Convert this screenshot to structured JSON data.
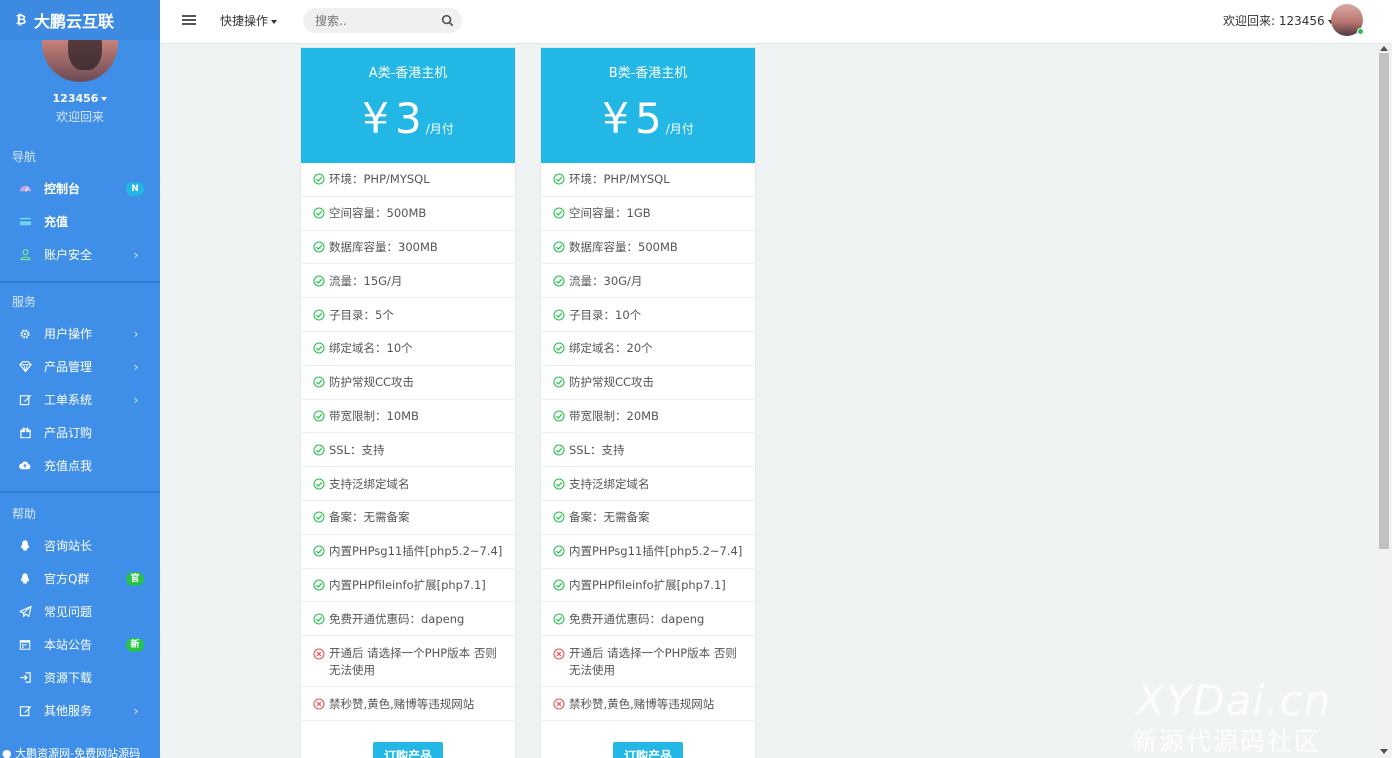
{
  "brand": {
    "logo_icon": "bitcoin-icon",
    "name": "大鹏云互联"
  },
  "user": {
    "name": "123456",
    "subtitle": "欢迎回来"
  },
  "sidebar": {
    "sections": [
      {
        "title": "导航",
        "items": [
          {
            "label": "控制台",
            "icon": "dashboard-icon",
            "badge": "N",
            "badge_color": "#23b7e5",
            "has_chevron": false
          },
          {
            "label": "充值",
            "icon": "credit-card-icon",
            "badge": "",
            "has_chevron": false
          },
          {
            "label": "账户安全",
            "icon": "user-icon",
            "badge": "",
            "has_chevron": true
          }
        ]
      },
      {
        "title": "服务",
        "items": [
          {
            "label": "用户操作",
            "icon": "gear-icon",
            "badge": "",
            "has_chevron": true
          },
          {
            "label": "产品管理",
            "icon": "diamond-icon",
            "badge": "",
            "has_chevron": true
          },
          {
            "label": "工单系统",
            "icon": "edit-icon",
            "badge": "",
            "has_chevron": true
          },
          {
            "label": "产品订购",
            "icon": "gift-icon",
            "badge": "",
            "has_chevron": false
          },
          {
            "label": "充值点我",
            "icon": "cloud-upload-icon",
            "badge": "",
            "has_chevron": false
          }
        ]
      },
      {
        "title": "帮助",
        "items": [
          {
            "label": "咨询站长",
            "icon": "qq-icon",
            "badge": "",
            "has_chevron": false
          },
          {
            "label": "官方Q群",
            "icon": "qq-icon",
            "badge": "官",
            "badge_color": "#27c24c",
            "has_chevron": false
          },
          {
            "label": "常见问题",
            "icon": "paper-plane-icon",
            "badge": "",
            "has_chevron": false
          },
          {
            "label": "本站公告",
            "icon": "calendar-icon",
            "badge": "新",
            "badge_color": "#27c24c",
            "has_chevron": false
          },
          {
            "label": "资源下载",
            "icon": "sign-in-icon",
            "badge": "",
            "has_chevron": false
          },
          {
            "label": "其他服务",
            "icon": "edit-icon",
            "badge": "",
            "has_chevron": true
          }
        ]
      }
    ],
    "footer": "大鹏资源网-免费网站源码"
  },
  "topbar": {
    "quick_actions": "快捷操作",
    "search_placeholder": "搜索..",
    "welcome": "欢迎回来: 123456"
  },
  "colors": {
    "sidebar": "#3f8fe8",
    "accent": "#23b7e5",
    "ok": "#27c24c",
    "error": "#f05050"
  },
  "plans": [
    {
      "title": "A类-香港主机",
      "currency": "¥",
      "price": "3",
      "unit": "/月付",
      "features": [
        {
          "ok": true,
          "text": "环境：PHP/MYSQL"
        },
        {
          "ok": true,
          "text": "空间容量：500MB"
        },
        {
          "ok": true,
          "text": "数据库容量：300MB"
        },
        {
          "ok": true,
          "text": "流量：15G/月"
        },
        {
          "ok": true,
          "text": "子目录：5个"
        },
        {
          "ok": true,
          "text": "绑定域名：10个"
        },
        {
          "ok": true,
          "text": "防护常规CC攻击"
        },
        {
          "ok": true,
          "text": "带宽限制：10MB"
        },
        {
          "ok": true,
          "text": "SSL：支持"
        },
        {
          "ok": true,
          "text": "支持泛绑定域名"
        },
        {
          "ok": true,
          "text": "备案：无需备案"
        },
        {
          "ok": true,
          "text": "内置PHPsg11插件[php5.2~7.4]"
        },
        {
          "ok": true,
          "text": "内置PHPfileinfo扩展[php7.1]"
        },
        {
          "ok": true,
          "text": "免费开通优惠码：dapeng"
        },
        {
          "ok": false,
          "text": "开通后 请选择一个PHP版本 否则无法使用"
        },
        {
          "ok": false,
          "text": "禁秒赞,黄色,赌博等违规网站"
        }
      ],
      "button": "订购产品"
    },
    {
      "title": "B类-香港主机",
      "currency": "¥",
      "price": "5",
      "unit": "/月付",
      "features": [
        {
          "ok": true,
          "text": "环境：PHP/MYSQL"
        },
        {
          "ok": true,
          "text": "空间容量：1GB"
        },
        {
          "ok": true,
          "text": "数据库容量：500MB"
        },
        {
          "ok": true,
          "text": "流量：30G/月"
        },
        {
          "ok": true,
          "text": "子目录：10个"
        },
        {
          "ok": true,
          "text": "绑定域名：20个"
        },
        {
          "ok": true,
          "text": "防护常规CC攻击"
        },
        {
          "ok": true,
          "text": "带宽限制：20MB"
        },
        {
          "ok": true,
          "text": "SSL：支持"
        },
        {
          "ok": true,
          "text": "支持泛绑定域名"
        },
        {
          "ok": true,
          "text": "备案：无需备案"
        },
        {
          "ok": true,
          "text": "内置PHPsg11插件[php5.2~7.4]"
        },
        {
          "ok": true,
          "text": "内置PHPfileinfo扩展[php7.1]"
        },
        {
          "ok": true,
          "text": "免费开通优惠码：dapeng"
        },
        {
          "ok": false,
          "text": "开通后 请选择一个PHP版本 否则无法使用"
        },
        {
          "ok": false,
          "text": "禁秒赞,黄色,赌博等违规网站"
        }
      ],
      "button": "订购产品"
    }
  ],
  "watermark": {
    "line1": "XYDai.cn",
    "line2": "新源代源码社区"
  }
}
